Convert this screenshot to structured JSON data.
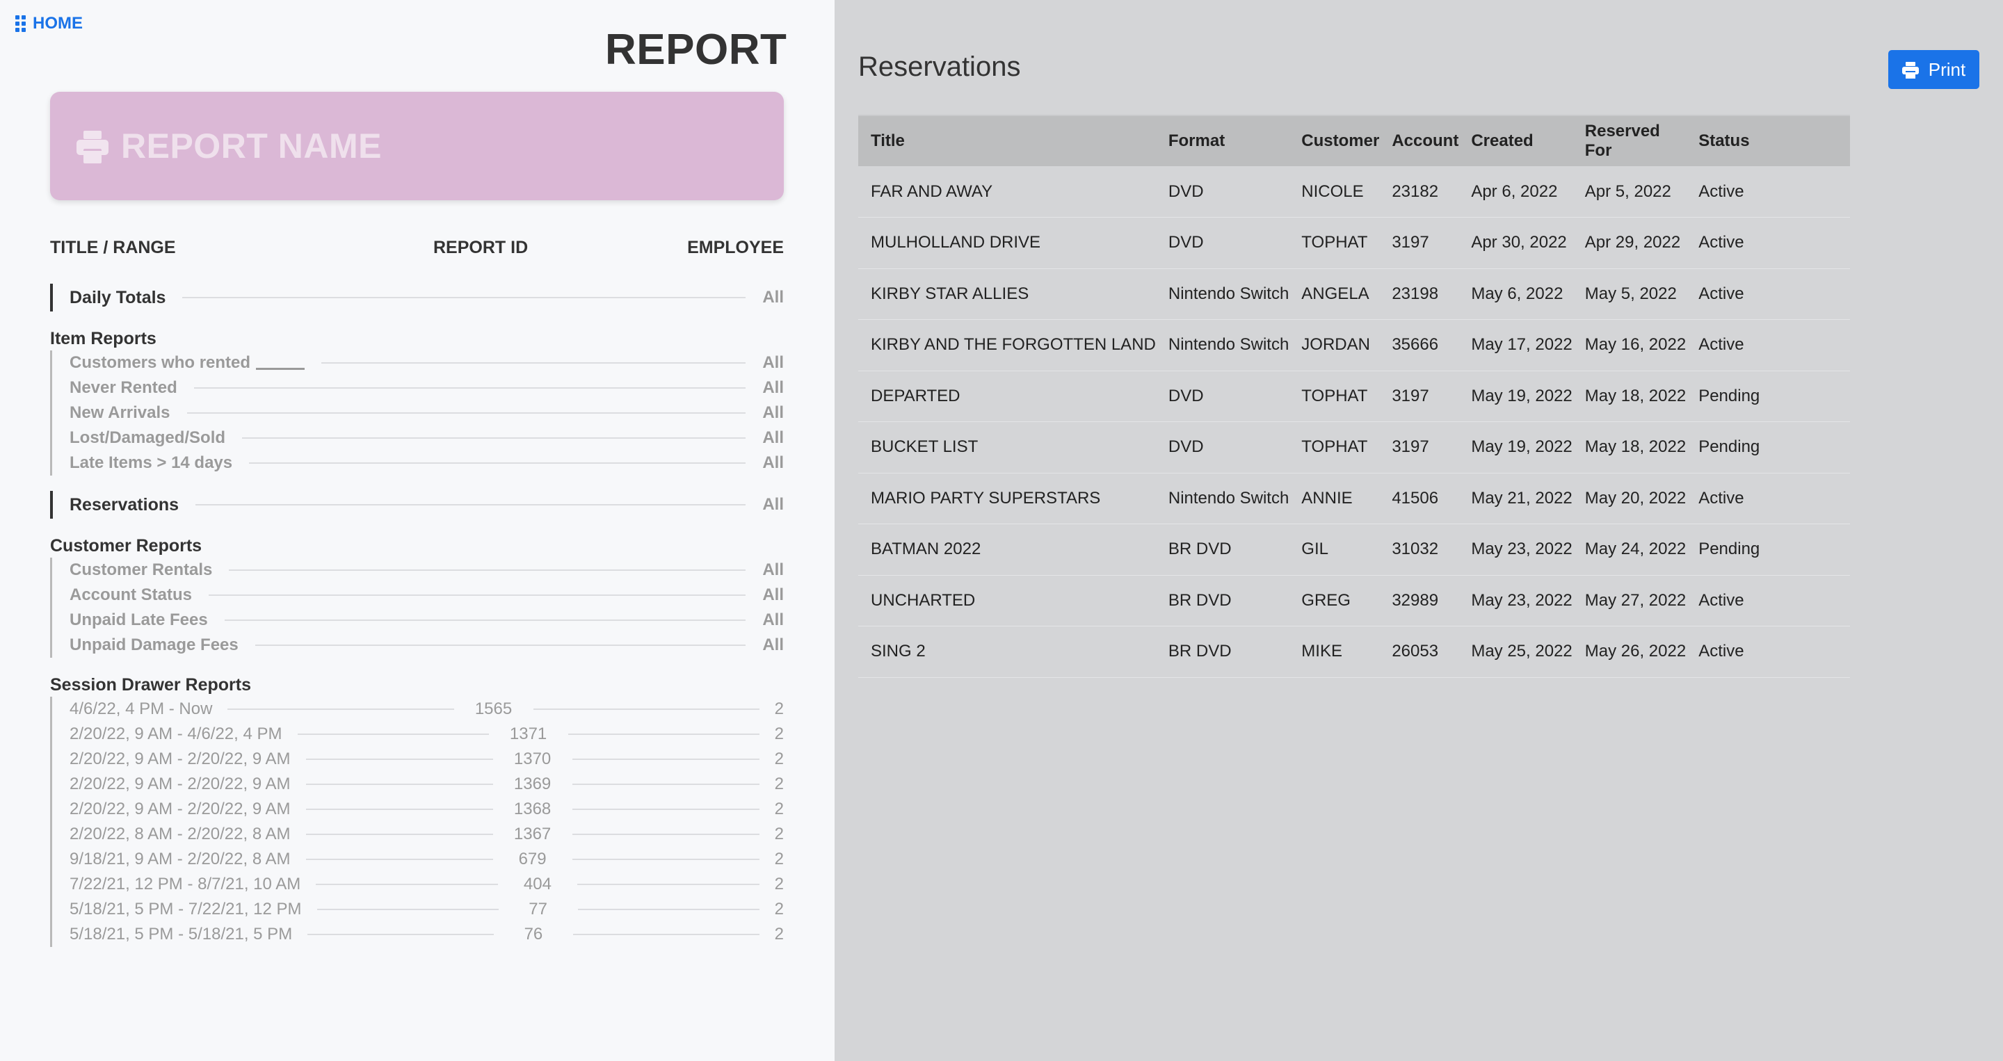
{
  "left": {
    "home_label": "HOME",
    "heading": "REPORT",
    "report_name": "REPORT NAME",
    "columns": {
      "title_range": "TITLE / RANGE",
      "report_id": "REPORT ID",
      "employee": "EMPLOYEE"
    },
    "daily_totals": {
      "label": "Daily Totals",
      "value": "All"
    },
    "item_reports": {
      "title": "Item Reports",
      "items": [
        {
          "label": "Customers who rented",
          "value": "All"
        },
        {
          "label": "Never Rented",
          "value": "All"
        },
        {
          "label": "New Arrivals",
          "value": "All"
        },
        {
          "label": "Lost/Damaged/Sold",
          "value": "All"
        },
        {
          "label": "Late Items > 14 days",
          "value": "All"
        }
      ]
    },
    "reservations": {
      "label": "Reservations",
      "value": "All"
    },
    "customer_reports": {
      "title": "Customer Reports",
      "items": [
        {
          "label": "Customer Rentals",
          "value": "All"
        },
        {
          "label": "Account Status",
          "value": "All"
        },
        {
          "label": "Unpaid Late Fees",
          "value": "All"
        },
        {
          "label": "Unpaid Damage Fees",
          "value": "All"
        }
      ]
    },
    "session_drawer_reports": {
      "title": "Session Drawer Reports",
      "items": [
        {
          "range": "4/6/22, 4 PM - Now",
          "id": "1565",
          "employee": "2"
        },
        {
          "range": "2/20/22, 9 AM - 4/6/22, 4 PM",
          "id": "1371",
          "employee": "2"
        },
        {
          "range": "2/20/22, 9 AM - 2/20/22, 9 AM",
          "id": "1370",
          "employee": "2"
        },
        {
          "range": "2/20/22, 9 AM - 2/20/22, 9 AM",
          "id": "1369",
          "employee": "2"
        },
        {
          "range": "2/20/22, 9 AM - 2/20/22, 9 AM",
          "id": "1368",
          "employee": "2"
        },
        {
          "range": "2/20/22, 8 AM - 2/20/22, 8 AM",
          "id": "1367",
          "employee": "2"
        },
        {
          "range": "9/18/21, 9 AM - 2/20/22, 8 AM",
          "id": "679",
          "employee": "2"
        },
        {
          "range": "7/22/21, 12 PM - 8/7/21, 10 AM",
          "id": "404",
          "employee": "2"
        },
        {
          "range": "5/18/21, 5 PM - 7/22/21, 12 PM",
          "id": "77",
          "employee": "2"
        },
        {
          "range": "5/18/21, 5 PM - 5/18/21, 5 PM",
          "id": "76",
          "employee": "2"
        }
      ]
    }
  },
  "right": {
    "title": "Reservations",
    "print_label": "Print",
    "table": {
      "headers": [
        "Title",
        "Format",
        "Customer",
        "Account",
        "Created",
        "Reserved For",
        "Status"
      ],
      "rows": [
        [
          "FAR AND AWAY",
          "DVD",
          "NICOLE",
          "23182",
          "Apr 6, 2022",
          "Apr 5, 2022",
          "Active"
        ],
        [
          "MULHOLLAND DRIVE",
          "DVD",
          "TOPHAT",
          "3197",
          "Apr 30, 2022",
          "Apr 29, 2022",
          "Active"
        ],
        [
          "KIRBY STAR ALLIES",
          "Nintendo Switch",
          "ANGELA",
          "23198",
          "May 6, 2022",
          "May 5, 2022",
          "Active"
        ],
        [
          "KIRBY AND THE FORGOTTEN LAND",
          "Nintendo Switch",
          "JORDAN",
          "35666",
          "May 17, 2022",
          "May 16, 2022",
          "Active"
        ],
        [
          "DEPARTED",
          "DVD",
          "TOPHAT",
          "3197",
          "May 19, 2022",
          "May 18, 2022",
          "Pending"
        ],
        [
          "BUCKET LIST",
          "DVD",
          "TOPHAT",
          "3197",
          "May 19, 2022",
          "May 18, 2022",
          "Pending"
        ],
        [
          "MARIO PARTY SUPERSTARS",
          "Nintendo Switch",
          "ANNIE",
          "41506",
          "May 21, 2022",
          "May 20, 2022",
          "Active"
        ],
        [
          "BATMAN 2022",
          "BR DVD",
          "GIL",
          "31032",
          "May 23, 2022",
          "May 24, 2022",
          "Pending"
        ],
        [
          "UNCHARTED",
          "BR DVD",
          "GREG",
          "32989",
          "May 23, 2022",
          "May 27, 2022",
          "Active"
        ],
        [
          "SING 2",
          "BR DVD",
          "MIKE",
          "26053",
          "May 25, 2022",
          "May 26, 2022",
          "Active"
        ]
      ]
    }
  },
  "colors": {
    "accent": "#1a73e8",
    "report_card": "#dbb8d6",
    "left_bg": "#f7f8fa",
    "right_bg": "#d4d5d7",
    "table_header_bg": "#bdbebf"
  },
  "icons": {
    "home": "grid-icon",
    "report_card": "printer-icon",
    "print_button": "printer-icon"
  }
}
